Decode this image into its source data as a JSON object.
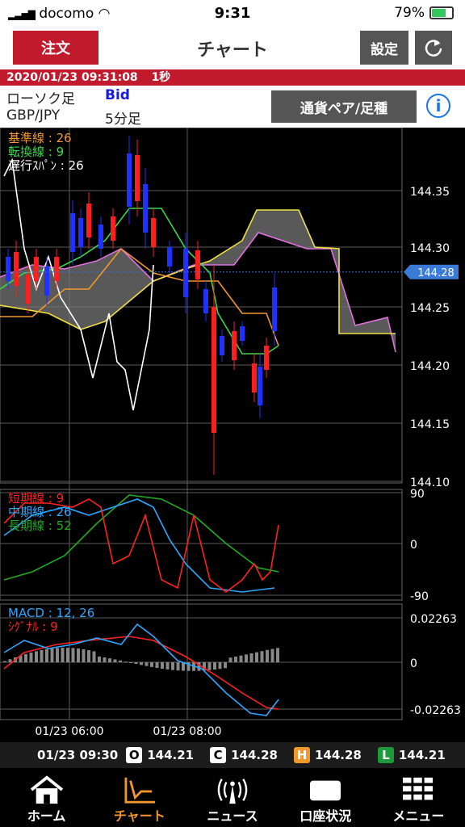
{
  "status_bar": {
    "carrier": "docomo",
    "time": "9:31",
    "battery": "79%",
    "battery_level": 0.79
  },
  "header": {
    "order_label": "注文",
    "title": "チャート",
    "settings_label": "設定"
  },
  "timestamp_bar": {
    "datetime": "2020/01/23 09:31:08",
    "interval": "1秒"
  },
  "info": {
    "chart_type": "ローソク足",
    "price_side": "Bid",
    "pair": "GBP/JPY",
    "timeframe": "5分足",
    "pair_button": "通貨ペア/足種"
  },
  "main_chart": {
    "y_ticks": [
      "144.35",
      "144.30",
      "144.25",
      "144.20",
      "144.15",
      "144.10"
    ],
    "current_price": "144.28",
    "legend": [
      {
        "label": "基準線 : 26",
        "color": "#f0982e"
      },
      {
        "label": "転換線 : 9",
        "color": "#38d84a"
      },
      {
        "label": "遅行ｽﾊﾟﾝ : 26",
        "color": "#ffffff"
      }
    ]
  },
  "ma_chart": {
    "y_ticks": [
      "90",
      "0",
      "-90"
    ],
    "legend": [
      {
        "label": "短期線 : 9",
        "color": "#ff2222"
      },
      {
        "label": "中期線 : 26",
        "color": "#2aa8ff"
      },
      {
        "label": "長期線 : 52",
        "color": "#22aa22"
      }
    ]
  },
  "macd_chart": {
    "y_ticks": [
      "0.02263",
      "0",
      "-0.02263"
    ],
    "legend": [
      {
        "label": "MACD : 12, 26",
        "color": "#2aa8ff"
      },
      {
        "label": "ｼｸﾞﾅﾙ : 9",
        "color": "#ff2222"
      }
    ]
  },
  "x_labels": [
    "01/23 06:00",
    "01/23 08:00"
  ],
  "ohlc_bar": {
    "datetime": "01/23 09:30",
    "open_label": "O",
    "open": "144.21",
    "close_label": "C",
    "close": "144.28",
    "high_label": "H",
    "high": "144.28",
    "low_label": "L",
    "low": "144.21"
  },
  "tabs": [
    {
      "label": "ホーム",
      "icon": "home-icon"
    },
    {
      "label": "チャート",
      "icon": "chart-icon",
      "active": true
    },
    {
      "label": "ニュース",
      "icon": "news-icon"
    },
    {
      "label": "口座状況",
      "icon": "account-icon"
    },
    {
      "label": "メニュー",
      "icon": "menu-icon"
    }
  ]
}
